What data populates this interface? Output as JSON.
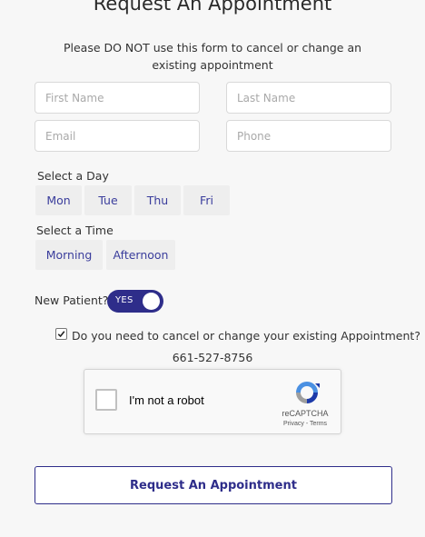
{
  "form": {
    "title": "Request An Appointment",
    "notice": "Please DO NOT use this form to cancel or change an existing appointment",
    "fields": {
      "first_name_placeholder": "First Name",
      "last_name_placeholder": "Last Name",
      "email_placeholder": "Email",
      "phone_placeholder": "Phone"
    },
    "day_section": {
      "label": "Select a Day",
      "options": [
        "Mon",
        "Tue",
        "Thu",
        "Fri"
      ]
    },
    "time_section": {
      "label": "Select a Time",
      "options": [
        "Morning",
        "Afternoon"
      ]
    },
    "new_patient": {
      "label": "New Patient?",
      "toggle_text": "YES",
      "toggle_on": true
    },
    "cancel_change": {
      "label": "Do you need to cancel or change your existing Appointment?",
      "checked": true,
      "phone": "661-527-8756"
    },
    "recaptcha": {
      "label": "I'm not a robot",
      "brand": "reCAPTCHA",
      "links": "Privacy - Terms"
    },
    "submit_label": "Request An Appointment"
  },
  "colors": {
    "accent": "#2e2d8a",
    "chip_text": "#3a3d9c",
    "chip_bg": "#eeeeee",
    "background": "#f7f7f7"
  }
}
